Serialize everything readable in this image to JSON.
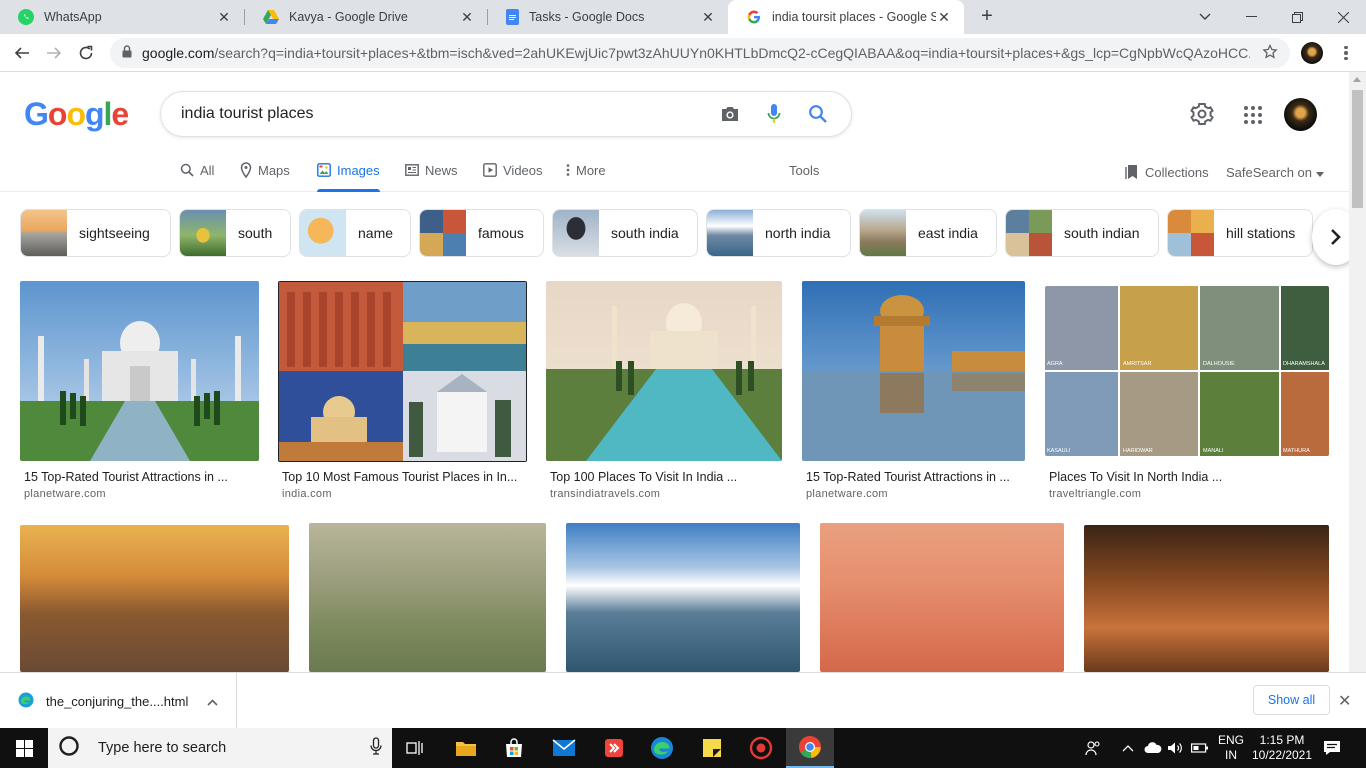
{
  "browser": {
    "tabs": [
      {
        "title": "WhatsApp",
        "icon": "whatsapp-icon"
      },
      {
        "title": "Kavya - Google Drive",
        "icon": "google-drive-icon"
      },
      {
        "title": "Tasks - Google Docs",
        "icon": "google-docs-icon"
      },
      {
        "title": "india toursit places - Google Sear",
        "icon": "google-icon",
        "active": true
      }
    ],
    "url_host": "google.com",
    "url_path": "/search?q=india+toursit+places+&tbm=isch&ved=2ahUKEwjUic7pwt3zAhUUYn0KHTLbDmcQ2-cCegQIABAA&oq=india+toursit+places+&gs_lcp=CgNpbWcQAzoHCC..."
  },
  "search": {
    "logo": [
      "G",
      "o",
      "o",
      "g",
      "l",
      "e"
    ],
    "query": "india tourist places"
  },
  "nav_tabs": {
    "all": "All",
    "maps": "Maps",
    "images": "Images",
    "news": "News",
    "videos": "Videos",
    "more": "More",
    "tools": "Tools",
    "collections": "Collections",
    "safesearch": "SafeSearch on"
  },
  "chips": [
    {
      "label": "sightseeing"
    },
    {
      "label": "south"
    },
    {
      "label": "name"
    },
    {
      "label": "famous"
    },
    {
      "label": "south india"
    },
    {
      "label": "north india"
    },
    {
      "label": "east india"
    },
    {
      "label": "south indian"
    },
    {
      "label": "hill stations"
    }
  ],
  "results": [
    {
      "caption": "15 Top-Rated Tourist Attractions in ...",
      "source": "planetware.com"
    },
    {
      "caption": "Top 10 Most Famous Tourist Places in In...",
      "source": "india.com"
    },
    {
      "caption": "Top 100 Places To Visit In India ...",
      "source": "transindiatravels.com"
    },
    {
      "caption": "15 Top-Rated Tourist Attractions in ...",
      "source": "planetware.com"
    },
    {
      "caption": "Places To Visit In North India ...",
      "source": "traveltriangle.com",
      "collage_labels": [
        "AGRA",
        "AMRITSAR",
        "DALHOUSIE",
        "DHARAMSHALA",
        "KASAULI",
        "HARIDWAR",
        "MANALI",
        "MATHURA"
      ]
    }
  ],
  "download_bar": {
    "file": "the_conjuring_the....html",
    "show_all": "Show all"
  },
  "taskbar": {
    "search_placeholder": "Type here to search",
    "lang_top": "ENG",
    "lang_bottom": "IN",
    "time": "1:15 PM",
    "date": "10/22/2021"
  },
  "colors": {
    "accent_blue": "#1a73e8",
    "google_blue": "#4285f4",
    "google_red": "#ea4335",
    "google_yellow": "#fbbc05",
    "google_green": "#34a853"
  }
}
